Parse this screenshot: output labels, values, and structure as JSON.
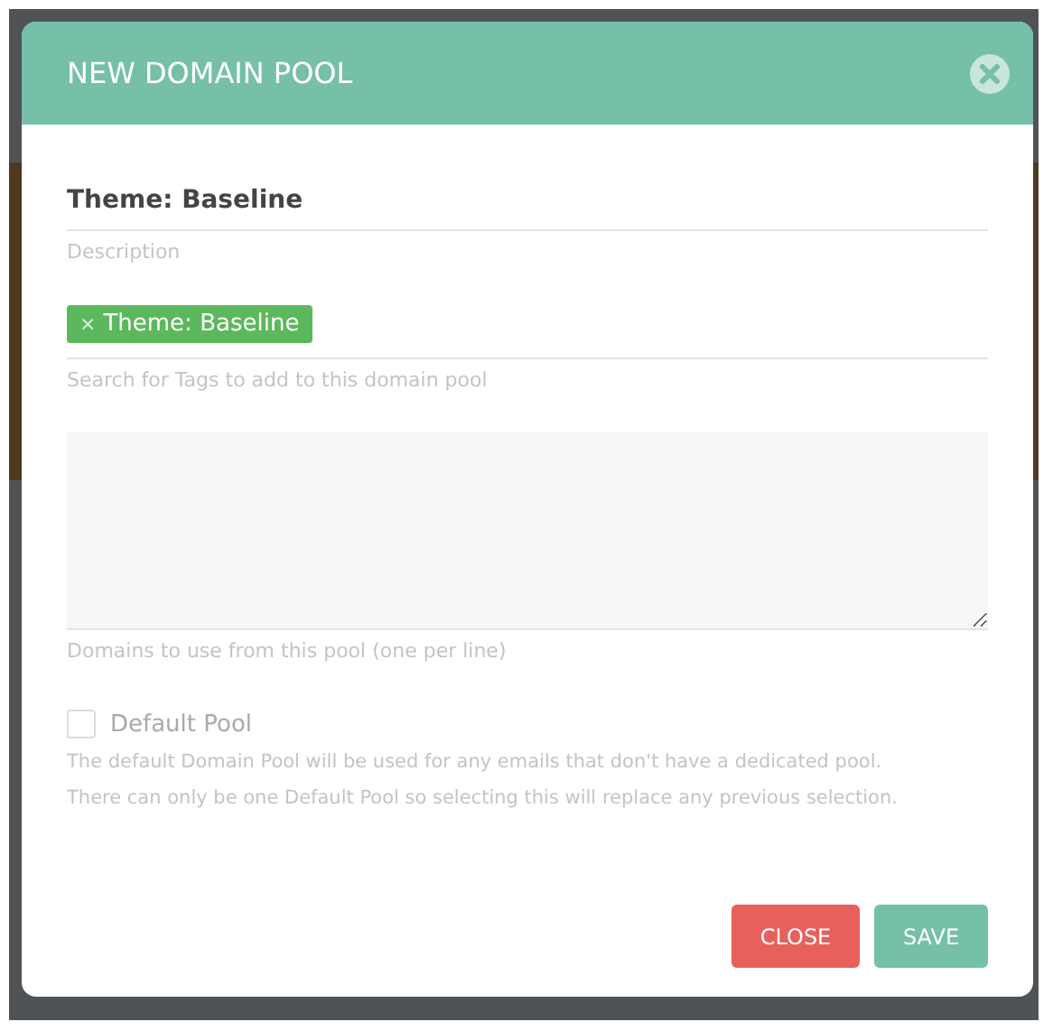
{
  "dialog": {
    "title": "NEW DOMAIN POOL"
  },
  "name_field": {
    "value": "Theme: Baseline",
    "hint": "Description"
  },
  "tags_field": {
    "tags": [
      {
        "label": "Theme: Baseline",
        "remove": "×"
      }
    ],
    "hint": "Search for Tags to add to this domain pool"
  },
  "domains_field": {
    "hint": "Domains to use from this pool (one per line)"
  },
  "default_pool": {
    "label": "Default Pool",
    "checked": false,
    "help": [
      "The default Domain Pool will be used for any emails that don't have a dedicated pool.",
      "There can only be one Default Pool so selecting this will replace any previous selection."
    ]
  },
  "buttons": [
    {
      "label": "CLOSE",
      "kind": "danger"
    },
    {
      "label": "SAVE",
      "kind": "primary"
    }
  ]
}
